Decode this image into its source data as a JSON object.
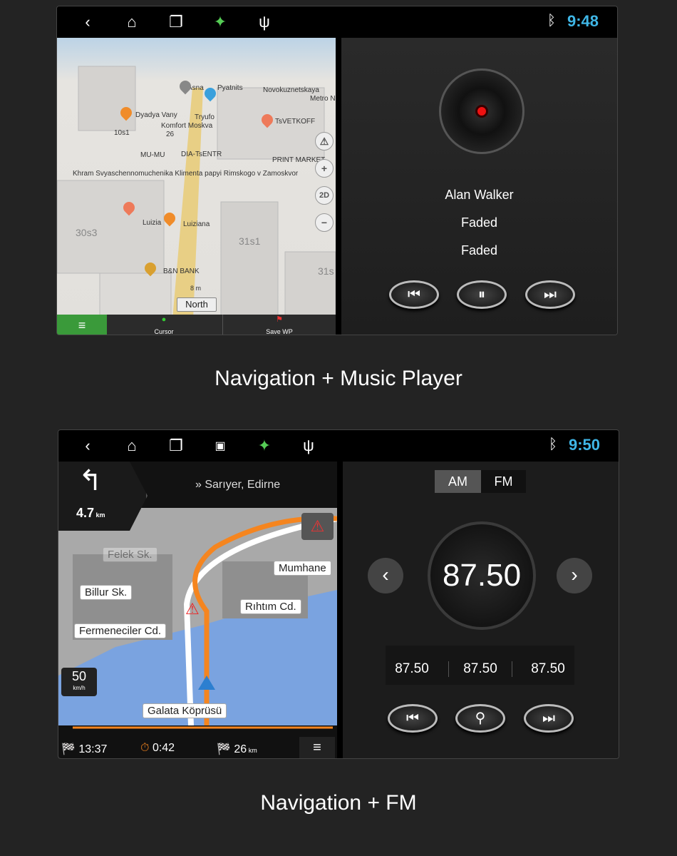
{
  "top": {
    "status": {
      "icons": [
        "back-icon",
        "home-icon",
        "recent-apps-icon",
        "gps-icon",
        "usb-icon"
      ],
      "bluetooth": "bluetooth-icon",
      "time": "9:48"
    },
    "map": {
      "labels": [
        "Asna",
        "Pyatnits",
        "Novokuznetskaya",
        "Metro N",
        "Dyadya Vany",
        "Tryufo",
        "Komfort Moskva",
        "10s1",
        "26",
        "TsVETKOFF",
        "MU-MU",
        "DIA-TsENTR",
        "PRINT MARKET",
        "Khram Svyaschennomuchenika Klimenta papyi Rimskogo v Zamoskvor",
        "Luizia",
        "Luiziana",
        "30s3",
        "31s1",
        "31s",
        "B&N BANK"
      ],
      "scale": "8 m",
      "orientation": "North",
      "controls": [
        "warning-icon",
        "+",
        "2D",
        "−"
      ],
      "bottom": {
        "cursor": "Cursor",
        "save": "Save WP"
      }
    },
    "music": {
      "artist": "Alan Walker",
      "title": "Faded",
      "album": "Faded",
      "buttons": [
        "previous",
        "pause",
        "next"
      ]
    },
    "caption": "Navigation + Music Player"
  },
  "bottom": {
    "status": {
      "icons": [
        "back-icon",
        "home-icon",
        "recent-apps-icon",
        "image-icon",
        "gps-icon",
        "usb-icon"
      ],
      "bluetooth": "bluetooth-icon",
      "time": "9:50"
    },
    "nav": {
      "distance": "4.7",
      "distance_unit": "km",
      "destination": "» Sarıyer, Edirne",
      "streets": [
        "Felek Sk.",
        "Billur Sk.",
        "Mumhane",
        "Rıhtım Cd.",
        "Fermeneciler Cd.",
        "Galata Köprüsü"
      ],
      "speed_limit": "50",
      "speed_unit": "km/h",
      "eta": "13:37",
      "remaining_time": "0:42",
      "remaining_distance": "26",
      "remaining_unit": "km"
    },
    "radio": {
      "bands": [
        "AM",
        "FM"
      ],
      "active_band": "AM",
      "frequency": "87.50",
      "presets": [
        "87.50",
        "87.50",
        "87.50"
      ]
    },
    "caption": "Navigation + FM"
  }
}
